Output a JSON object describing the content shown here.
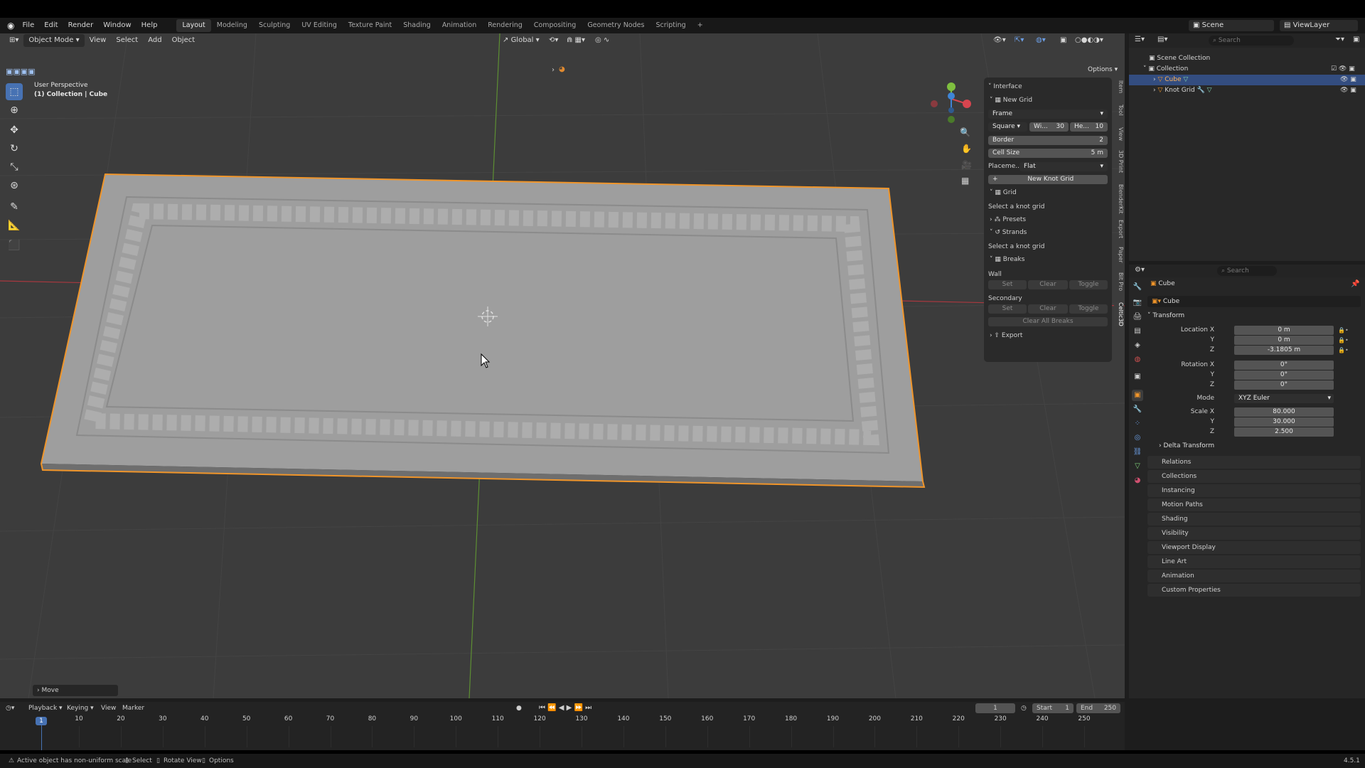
{
  "topbar": {
    "menus": [
      "File",
      "Edit",
      "Render",
      "Window",
      "Help"
    ],
    "workspaces": [
      "Layout",
      "Modeling",
      "Sculpting",
      "UV Editing",
      "Texture Paint",
      "Shading",
      "Animation",
      "Rendering",
      "Compositing",
      "Geometry Nodes",
      "Scripting"
    ],
    "active_workspace": "Layout",
    "scene": "Scene",
    "view_layer": "ViewLayer"
  },
  "viewport": {
    "mode": "Object Mode",
    "menus": [
      "View",
      "Select",
      "Add",
      "Object"
    ],
    "orientation": "Global",
    "options": "Options",
    "overlay_title": "User Perspective",
    "overlay_subtitle": "(1) Collection | Cube",
    "last_op": "Move"
  },
  "npanel": {
    "interface": "Interface",
    "new_grid": "New Grid",
    "frame": "Frame",
    "shape": "Square",
    "width_label": "Wi...",
    "width_value": "30",
    "height_label": "He...",
    "height_value": "10",
    "border_label": "Border",
    "border_value": "2",
    "cell_size_label": "Cell Size",
    "cell_size_value": "5 m",
    "placement_label": "Placeme...",
    "placement_value": "Flat",
    "new_knot_grid": "New Knot Grid",
    "grid": "Grid",
    "select_knot_grid_1": "Select a knot grid",
    "presets": "Presets",
    "strands": "Strands",
    "select_knot_grid_2": "Select a knot grid",
    "breaks": "Breaks",
    "wall": "Wall",
    "set": "Set",
    "clear": "Clear",
    "toggle": "Toggle",
    "secondary": "Secondary",
    "clear_all_breaks": "Clear All Breaks",
    "export": "Export",
    "tabs": [
      "Item",
      "Tool",
      "View",
      "3D Print",
      "BlenderKit",
      "Export",
      "Paper",
      "Bit Pro",
      "Celtic3D"
    ]
  },
  "outliner": {
    "search_placeholder": "Search",
    "scene_collection": "Scene Collection",
    "collection": "Collection",
    "items": [
      "Cube",
      "Knot Grid"
    ]
  },
  "properties": {
    "search_placeholder": "Search",
    "object_name": "Cube",
    "data_name": "Cube",
    "transform": "Transform",
    "location_x_label": "Location X",
    "location_x": "0 m",
    "location_y": "0 m",
    "location_z": "-3.1805 m",
    "rotation_x_label": "Rotation X",
    "rotation_x": "0°",
    "rotation_y": "0°",
    "rotation_z": "0°",
    "mode_label": "Mode",
    "mode_value": "XYZ Euler",
    "scale_x_label": "Scale X",
    "scale_x": "80.000",
    "scale_y": "30.000",
    "scale_z": "2.500",
    "y_label": "Y",
    "z_label": "Z",
    "delta_transform": "Delta Transform",
    "panels": [
      "Relations",
      "Collections",
      "Instancing",
      "Motion Paths",
      "Shading",
      "Visibility",
      "Viewport Display",
      "Line Art",
      "Animation",
      "Custom Properties"
    ]
  },
  "timeline": {
    "menus": [
      "Playback",
      "Keying",
      "View",
      "Marker"
    ],
    "current_frame": "1",
    "start_label": "Start",
    "start": "1",
    "end_label": "End",
    "end": "250",
    "ticks": [
      "10",
      "20",
      "30",
      "40",
      "50",
      "60",
      "70",
      "80",
      "90",
      "100",
      "110",
      "120",
      "130",
      "140",
      "150",
      "160",
      "170",
      "180",
      "190",
      "200",
      "210",
      "220",
      "230",
      "240",
      "250"
    ],
    "playhead": "1"
  },
  "status": {
    "warning": "Active object has non-uniform scale",
    "select": "Select",
    "rotate": "Rotate View",
    "options": "Options",
    "version": "4.5.1"
  },
  "colors": {
    "accent": "#4772b3",
    "selection": "#f0952a",
    "x_axis": "#d6454f",
    "y_axis": "#7fbf3f",
    "z_axis": "#3f85d6"
  }
}
